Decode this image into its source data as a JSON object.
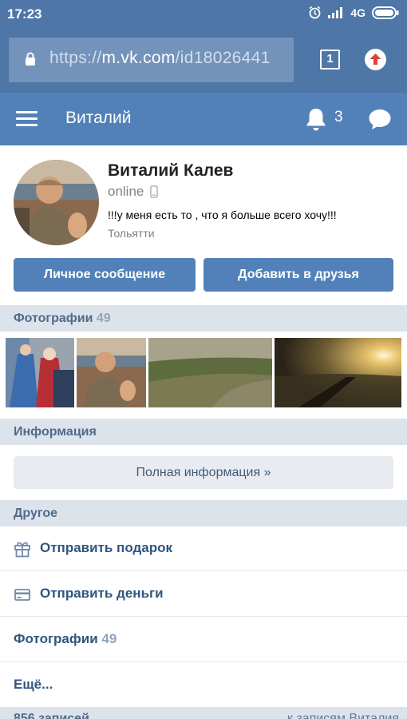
{
  "status_bar": {
    "time": "17:23",
    "network": "4G"
  },
  "browser": {
    "url_scheme": "https://",
    "url_host": "m.vk.com",
    "url_path": "/id18026441",
    "tabs_count": "1"
  },
  "header": {
    "title": "Виталий",
    "notifications_count": "3"
  },
  "profile": {
    "name": "Виталий Калев",
    "online": "online",
    "status": "!!!у меня есть то , что я больше всего хочу!!!",
    "city": "Тольятти",
    "message_button": "Личное сообщение",
    "add_friend_button": "Добавить в друзья"
  },
  "photos": {
    "label": "Фотографии",
    "count": "49"
  },
  "info": {
    "label": "Информация",
    "full_info": "Полная информация »"
  },
  "other": {
    "label": "Другое",
    "send_gift": "Отправить подарок",
    "send_money": "Отправить деньги",
    "photos_label": "Фотографии",
    "photos_count": "49",
    "more": "Ещё..."
  },
  "posts": {
    "count_label": "856 записей",
    "link": "к записям Виталия"
  },
  "colors": {
    "header": "#5181b8",
    "browser_bar": "#4e76a7",
    "button": "#5181b8",
    "link": "#2f5580"
  }
}
